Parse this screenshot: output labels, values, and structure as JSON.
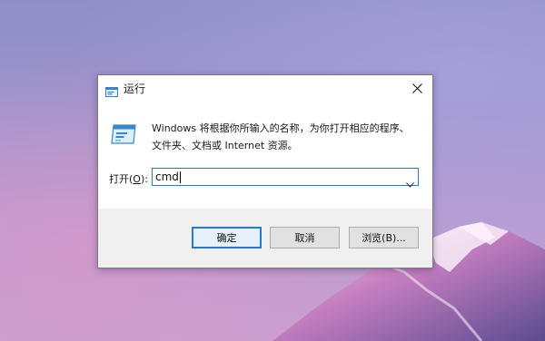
{
  "dialog": {
    "title": "运行",
    "description_line1": "Windows 将根据你所输入的名称，为你打开相应的程序、",
    "description_line2": "文件夹、文档或 Internet 资源。",
    "open_label_prefix": "打开(",
    "open_label_mnemonic": "O",
    "open_label_suffix": "):",
    "input_value": "cmd",
    "buttons": {
      "ok": "确定",
      "cancel": "取消",
      "browse": "浏览(B)..."
    }
  },
  "colors": {
    "accent": "#2b78d4",
    "footer_bg": "#f0f0f0",
    "button_bg": "#e1e1e1"
  },
  "icons": {
    "title": "run-app-icon",
    "close": "close-icon",
    "run": "run-app-icon",
    "dropdown": "chevron-down-icon"
  }
}
